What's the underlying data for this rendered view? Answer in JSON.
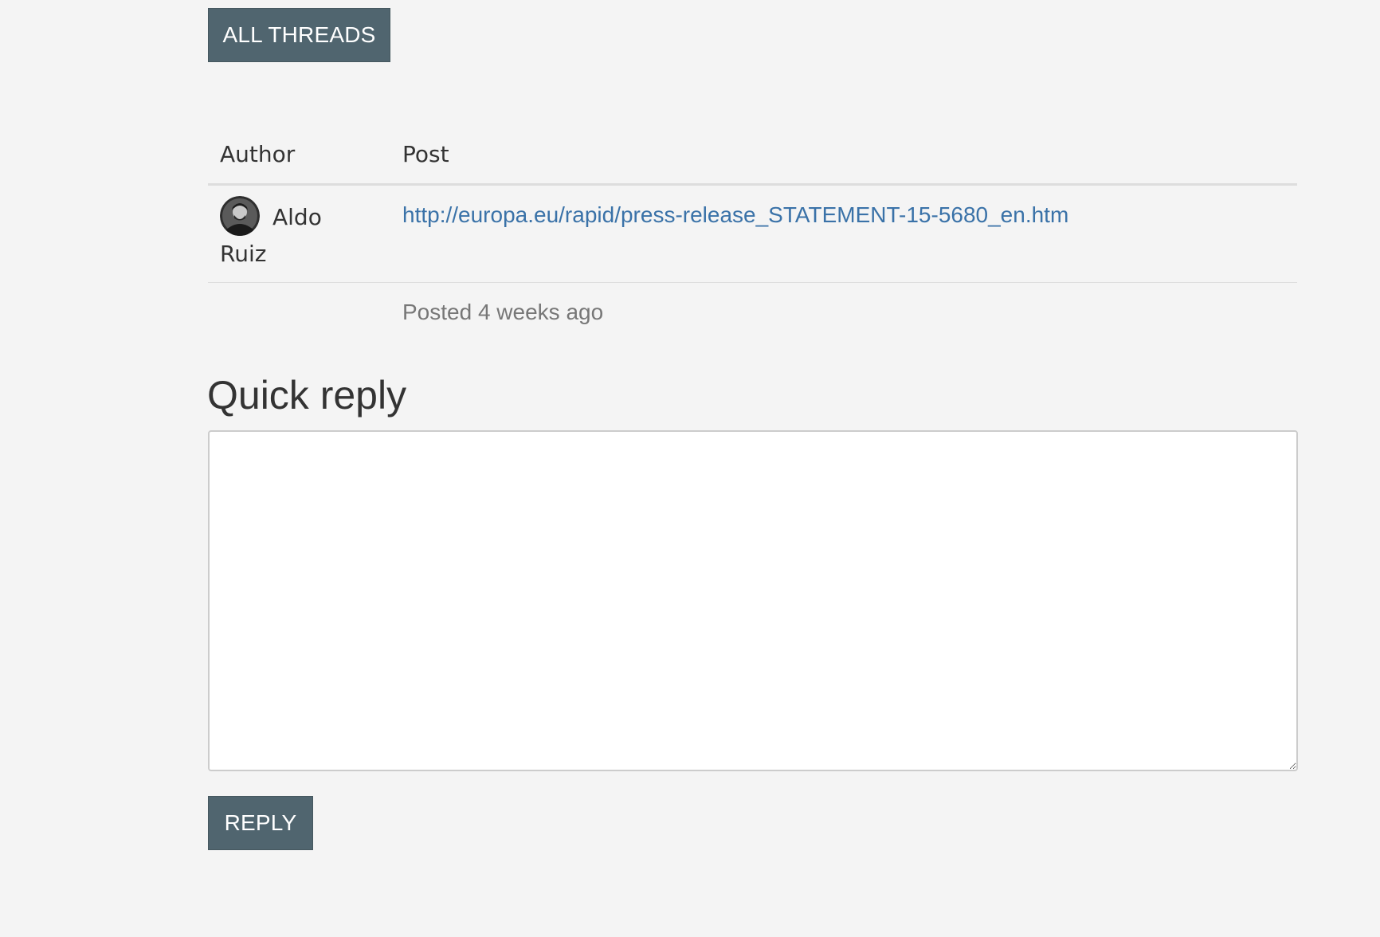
{
  "nav": {
    "all_threads_label": "ALL THREADS"
  },
  "table": {
    "headers": {
      "author": "Author",
      "post": "Post"
    },
    "rows": [
      {
        "author_first": "Aldo",
        "author_last": "Ruiz",
        "post_link": "http://europa.eu/rapid/press-release_STATEMENT-15-5680_en.htm",
        "posted": "Posted 4 weeks ago"
      }
    ]
  },
  "quick_reply": {
    "heading": "Quick reply",
    "textarea_value": "",
    "reply_label": "REPLY"
  },
  "colors": {
    "button_bg": "#50656f",
    "link": "#3a72a8",
    "page_bg": "#f4f4f4"
  }
}
